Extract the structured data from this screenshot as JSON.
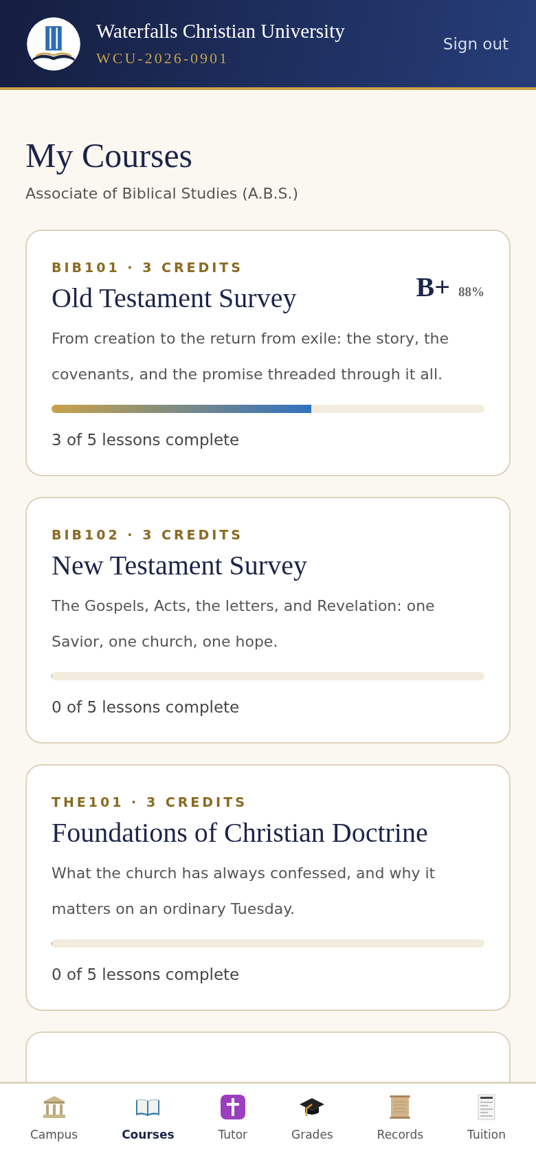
{
  "header": {
    "title": "Waterfalls Christian University",
    "student_id": "WCU-2026-0901",
    "sign_out": "Sign out"
  },
  "page": {
    "title": "My Courses",
    "subtitle": "Associate of Biblical Studies (A.B.S.)"
  },
  "courses": [
    {
      "code": "BIB101 · 3 CREDITS",
      "title": "Old Testament Survey",
      "grade": "B+",
      "percent": "88%",
      "description": "From creation to the return from exile: the story, the covenants, and the promise threaded through it all.",
      "level": 0.6,
      "progress": "3 of 5 lessons complete"
    },
    {
      "code": "BIB102 · 3 CREDITS",
      "title": "New Testament Survey",
      "description": "The Gospels, Acts, the letters, and Revelation: one Savior, one church, one hope.",
      "level": 0,
      "progress": "0 of 5 lessons complete"
    },
    {
      "code": "THE101 · 3 CREDITS",
      "title": "Foundations of Christian Doctrine",
      "description": "What the church has always confessed, and why it matters on an ordinary Tuesday.",
      "level": 0,
      "progress": "0 of 5 lessons complete"
    }
  ],
  "nav": [
    {
      "kind": "temple",
      "label": "Campus",
      "selected": false
    },
    {
      "kind": "book",
      "label": "Courses",
      "selected": true
    },
    {
      "kind": "cross",
      "label": "Tutor",
      "selected": false
    },
    {
      "kind": "cap",
      "label": "Grades",
      "selected": false
    },
    {
      "kind": "scroll",
      "label": "Records",
      "selected": false
    },
    {
      "kind": "receipt",
      "label": "Tuition",
      "selected": false
    }
  ]
}
